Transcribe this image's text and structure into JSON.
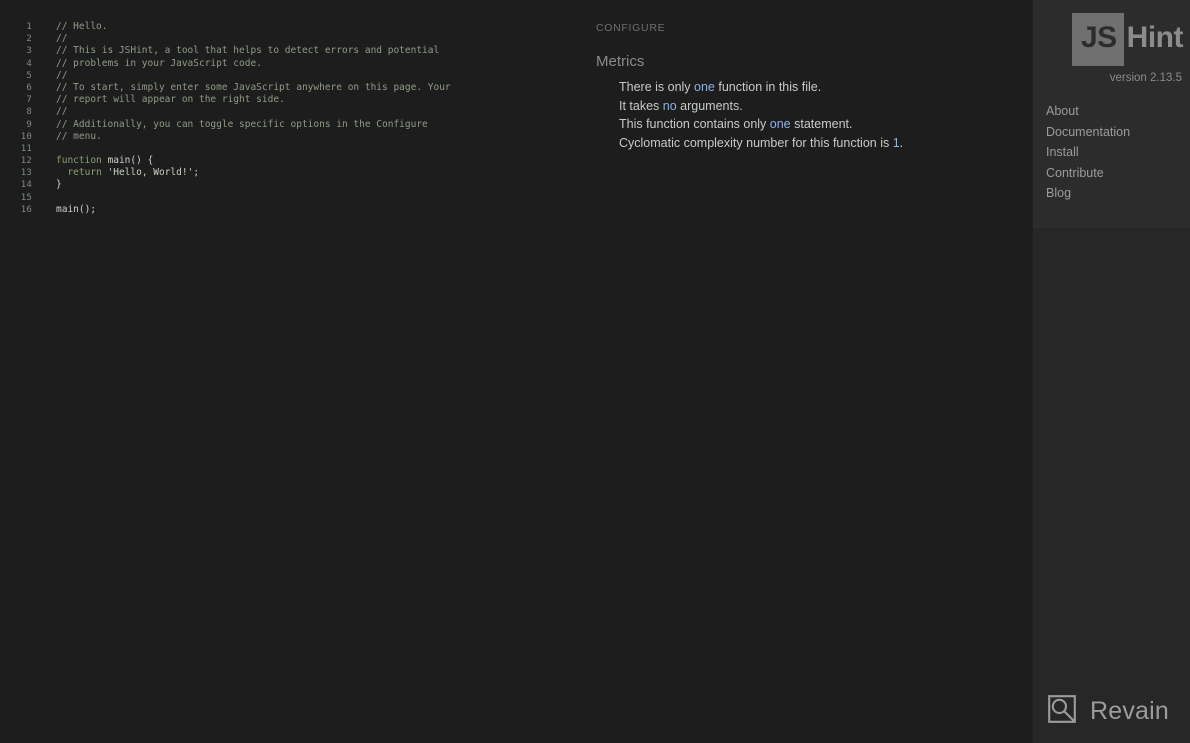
{
  "editor": {
    "name": "jshint-code-editor",
    "language": "javascript",
    "line_numbers": [
      1,
      2,
      3,
      4,
      5,
      6,
      7,
      8,
      9,
      10,
      11,
      12,
      13,
      14,
      15,
      16
    ],
    "lines": [
      {
        "n": 1,
        "tokens": [
          {
            "t": "comment",
            "s": "// Hello."
          }
        ]
      },
      {
        "n": 2,
        "tokens": [
          {
            "t": "comment",
            "s": "//"
          }
        ]
      },
      {
        "n": 3,
        "tokens": [
          {
            "t": "comment",
            "s": "// This is JSHint, a tool that helps to detect errors and potential"
          }
        ]
      },
      {
        "n": 4,
        "tokens": [
          {
            "t": "comment",
            "s": "// problems in your JavaScript code."
          }
        ]
      },
      {
        "n": 5,
        "tokens": [
          {
            "t": "comment",
            "s": "//"
          }
        ]
      },
      {
        "n": 6,
        "tokens": [
          {
            "t": "comment",
            "s": "// To start, simply enter some JavaScript anywhere on this page. Your"
          }
        ]
      },
      {
        "n": 7,
        "tokens": [
          {
            "t": "comment",
            "s": "// report will appear on the right side."
          }
        ]
      },
      {
        "n": 8,
        "tokens": [
          {
            "t": "comment",
            "s": "//"
          }
        ]
      },
      {
        "n": 9,
        "tokens": [
          {
            "t": "comment",
            "s": "// Additionally, you can toggle specific options in the Configure"
          }
        ]
      },
      {
        "n": 10,
        "tokens": [
          {
            "t": "comment",
            "s": "// menu."
          }
        ]
      },
      {
        "n": 11,
        "tokens": [
          {
            "t": "plain",
            "s": ""
          }
        ]
      },
      {
        "n": 12,
        "tokens": [
          {
            "t": "kw",
            "s": "function"
          },
          {
            "t": "plain",
            "s": " "
          },
          {
            "t": "fn",
            "s": "main"
          },
          {
            "t": "punc",
            "s": "() {"
          }
        ]
      },
      {
        "n": 13,
        "tokens": [
          {
            "t": "plain",
            "s": "  "
          },
          {
            "t": "kw",
            "s": "return"
          },
          {
            "t": "plain",
            "s": " "
          },
          {
            "t": "str",
            "s": "'Hello, World!'"
          },
          {
            "t": "punc",
            "s": ";"
          }
        ]
      },
      {
        "n": 14,
        "tokens": [
          {
            "t": "punc",
            "s": "}"
          }
        ]
      },
      {
        "n": 15,
        "tokens": [
          {
            "t": "plain",
            "s": ""
          }
        ]
      },
      {
        "n": 16,
        "tokens": [
          {
            "t": "fn",
            "s": "main"
          },
          {
            "t": "punc",
            "s": "();"
          }
        ]
      }
    ]
  },
  "results": {
    "configure_label": "CONFIGURE",
    "metrics_heading": "Metrics",
    "metrics": [
      {
        "parts": [
          {
            "t": "text",
            "s": "There is only "
          },
          {
            "t": "hl",
            "s": "one"
          },
          {
            "t": "text",
            "s": " function in this file."
          }
        ]
      },
      {
        "parts": [
          {
            "t": "text",
            "s": "It takes "
          },
          {
            "t": "hl",
            "s": "no"
          },
          {
            "t": "text",
            "s": " arguments."
          }
        ]
      },
      {
        "parts": [
          {
            "t": "text",
            "s": "This function contains only "
          },
          {
            "t": "hl",
            "s": "one"
          },
          {
            "t": "text",
            "s": " statement."
          }
        ]
      },
      {
        "parts": [
          {
            "t": "text",
            "s": "Cyclomatic complexity number for this function is "
          },
          {
            "t": "hl",
            "s": "1"
          },
          {
            "t": "text",
            "s": "."
          }
        ]
      }
    ]
  },
  "sidebar": {
    "brand": {
      "js": "JS",
      "hint": "Hint"
    },
    "version": "version 2.13.5",
    "nav": [
      {
        "label": "About"
      },
      {
        "label": "Documentation"
      },
      {
        "label": "Install"
      },
      {
        "label": "Contribute"
      },
      {
        "label": "Blog"
      }
    ],
    "footer": {
      "brand_text": "Revain",
      "icon": "revain-logo-icon"
    }
  },
  "colors": {
    "editor_bg": "#1c1d1c",
    "sidebar_bg": "#2c2c2c",
    "sidebar_bg_lower": "#262726",
    "comment": "#8f9c87",
    "keyword": "#89a06f",
    "metric_text": "#c7cbc7",
    "metric_highlight": "#8ab4e8",
    "nav_link": "#9a9b9a",
    "brand_js_bg": "#6f706f",
    "brand_hint": "#8b8c8b"
  }
}
